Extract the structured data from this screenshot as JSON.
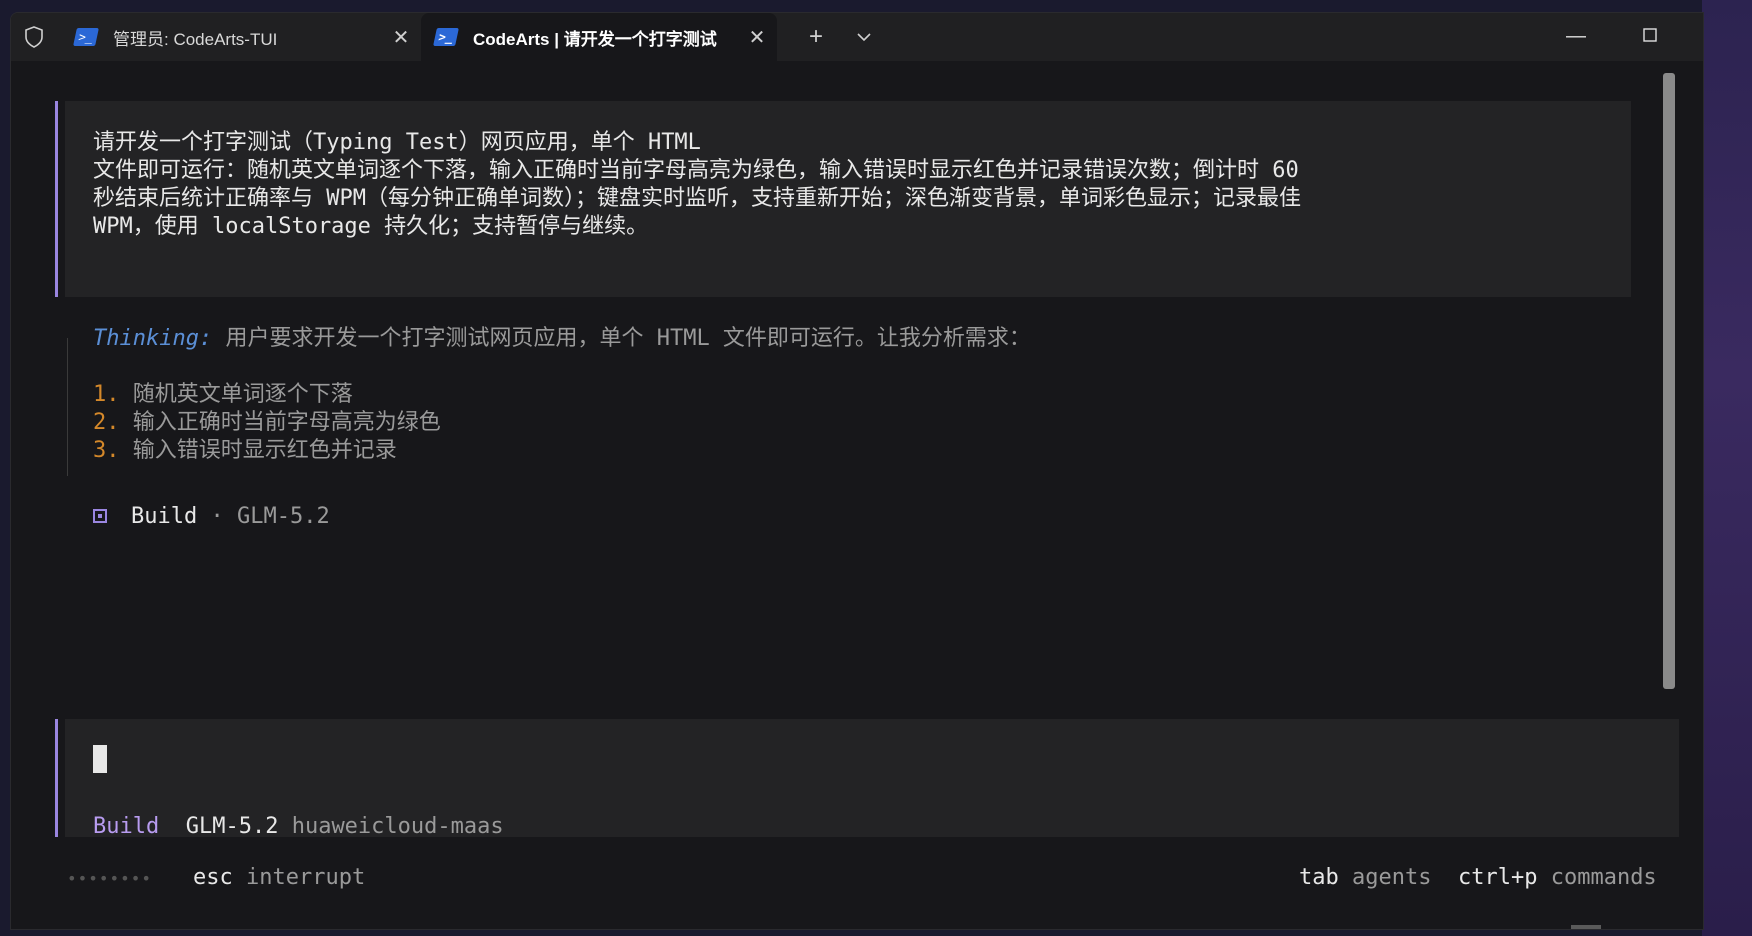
{
  "tabs": [
    {
      "title": "管理员: CodeArts-TUI",
      "close": "✕"
    },
    {
      "title": "CodeArts | 请开发一个打字测试",
      "close": "✕"
    }
  ],
  "tabbar": {
    "new_tab": "+",
    "dropdown": "⌄"
  },
  "window_controls": {
    "minimize": "—",
    "maximize": "☐",
    "close": "✕"
  },
  "prompt": {
    "lines": [
      "请开发一个打字测试（Typing Test）网页应用，单个 HTML",
      "文件即可运行：随机英文单词逐个下落，输入正确时当前字母高亮为绿色，输入错误时显示红色并记录错误次数；倒计时 60",
      "秒结束后统计正确率与 WPM（每分钟正确单词数）；键盘实时监听，支持重新开始；深色渐变背景，单词彩色显示；记录最佳",
      "WPM，使用 localStorage 持久化；支持暂停与继续。"
    ]
  },
  "thinking": {
    "label": "Thinking:",
    "text": " 用户要求开发一个打字测试网页应用，单个 HTML 文件即可运行。让我分析需求：",
    "items": [
      {
        "num": "1.",
        "text": " 随机英文单词逐个下落"
      },
      {
        "num": "2.",
        "text": " 输入正确时当前字母高亮为绿色"
      },
      {
        "num": "3.",
        "text": " 输入错误时显示红色并记录"
      }
    ]
  },
  "build_status": {
    "agent": "Build",
    "sep": " · ",
    "model": "GLM-5.2"
  },
  "input": {
    "agent": "Build",
    "model": "GLM-5.2",
    "provider": "huaweicloud-maas"
  },
  "footer": {
    "dots": "••••••••",
    "esc_key": "esc",
    "esc_label": "interrupt",
    "tab_key": "tab",
    "tab_label": "agents",
    "cmd_key": "ctrl+p",
    "cmd_label": "commands"
  },
  "colors": {
    "accent": "#9a86e0",
    "thinking": "#5b8fd6",
    "list_number": "#d4882a",
    "agent": "#b89cf0"
  }
}
